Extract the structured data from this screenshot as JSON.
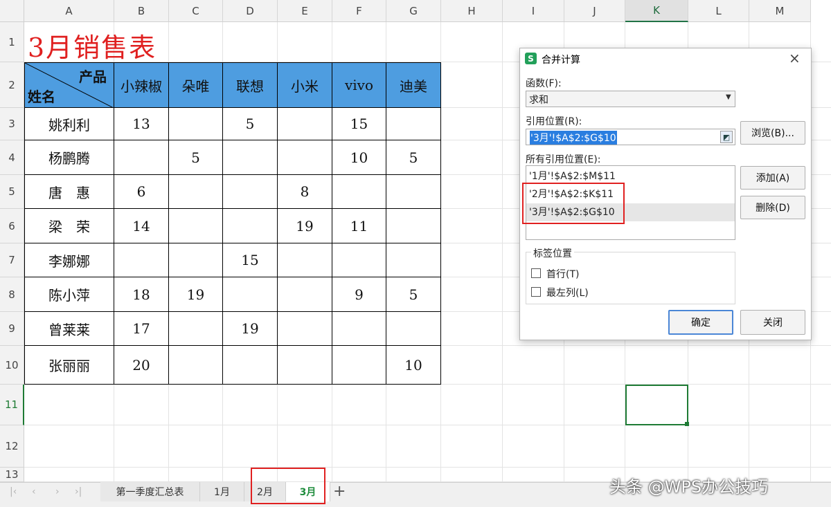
{
  "columns": [
    "A",
    "B",
    "C",
    "D",
    "E",
    "F",
    "G",
    "H",
    "I",
    "J",
    "K",
    "L",
    "M"
  ],
  "rows": [
    "1",
    "2",
    "3",
    "4",
    "5",
    "6",
    "7",
    "8",
    "9",
    "10",
    "11",
    "12",
    "13"
  ],
  "sheet": {
    "title": "3月销售表",
    "corner_top": "产品",
    "corner_bottom": "姓名",
    "products": [
      "小辣椒",
      "朵唯",
      "联想",
      "小米",
      "vivo",
      "迪美"
    ],
    "records": [
      {
        "name": "姚利利",
        "values": [
          "13",
          "",
          "5",
          "",
          "15",
          ""
        ]
      },
      {
        "name": "杨鹏腾",
        "values": [
          "",
          "5",
          "",
          "",
          "10",
          "5"
        ]
      },
      {
        "name": "唐　惠",
        "values": [
          "6",
          "",
          "",
          "8",
          "",
          ""
        ]
      },
      {
        "name": "梁　荣",
        "values": [
          "14",
          "",
          "",
          "19",
          "11",
          ""
        ]
      },
      {
        "name": "李娜娜",
        "values": [
          "",
          "",
          "15",
          "",
          "",
          ""
        ]
      },
      {
        "name": "陈小萍",
        "values": [
          "18",
          "19",
          "",
          "",
          "9",
          "5"
        ]
      },
      {
        "name": "曾莱莱",
        "values": [
          "17",
          "",
          "19",
          "",
          "",
          ""
        ]
      },
      {
        "name": "张丽丽",
        "values": [
          "20",
          "",
          "",
          "",
          "",
          "10"
        ]
      }
    ]
  },
  "dialog": {
    "title": "合并计算",
    "logo": "S",
    "function_label": "函数(F):",
    "function_value": "求和",
    "ref_label": "引用位置(R):",
    "ref_value": "'3月'!$A$2:$G$10",
    "all_refs_label": "所有引用位置(E):",
    "all_refs": [
      "'1月'!$A$2:$M$11",
      "'2月'!$A$2:$K$11",
      "'3月'!$A$2:$G$10"
    ],
    "browse": "浏览(B)...",
    "add": "添加(A)",
    "delete": "删除(D)",
    "label_group": "标签位置",
    "first_row": "首行(T)",
    "left_col": "最左列(L)",
    "ok": "确定",
    "close": "关闭"
  },
  "tabs": [
    "第一季度汇总表",
    "1月",
    "2月",
    "3月"
  ],
  "active_tab": "3月",
  "add_sheet": "+",
  "watermark": "头条 @WPS办公技巧",
  "colors": {
    "header_fill": "#4e9de0",
    "title": "#e02020",
    "highlight_box": "#e02020",
    "selection": "#1e7b34"
  }
}
